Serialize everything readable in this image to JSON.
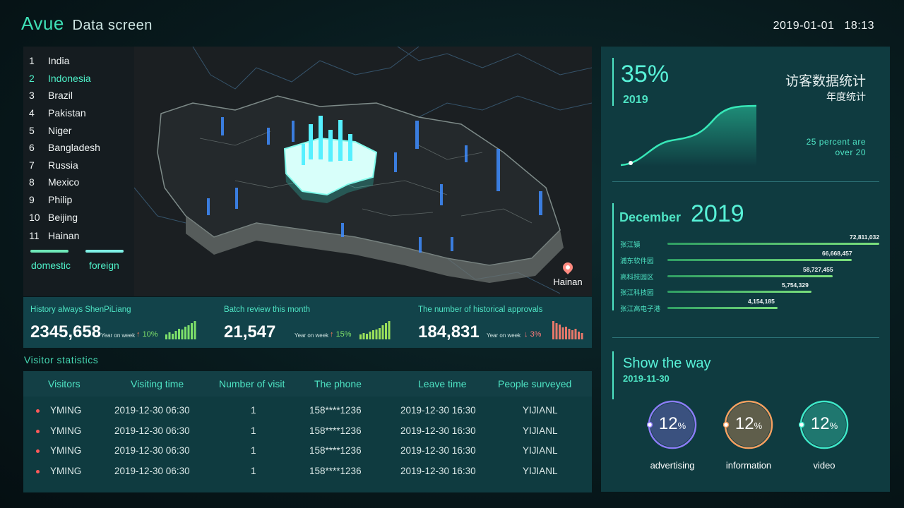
{
  "header": {
    "brand": "Avue",
    "brand_sub": "Data screen",
    "date": "2019-01-01",
    "time": "18:13"
  },
  "map": {
    "ranking": [
      {
        "num": "1",
        "name": "India"
      },
      {
        "num": "2",
        "name": "Indonesia"
      },
      {
        "num": "3",
        "name": "Brazil"
      },
      {
        "num": "4",
        "name": "Pakistan"
      },
      {
        "num": "5",
        "name": "Niger"
      },
      {
        "num": "6",
        "name": "Bangladesh"
      },
      {
        "num": "7",
        "name": "Russia"
      },
      {
        "num": "8",
        "name": "Mexico"
      },
      {
        "num": "9",
        "name": "Philip"
      },
      {
        "num": "10",
        "name": "Beijing"
      },
      {
        "num": "11",
        "name": "Hainan"
      }
    ],
    "legend": {
      "domestic": "domestic",
      "foreign": "foreign"
    },
    "location_label": "Hainan",
    "colors": {
      "domestic": "#6ee7b7",
      "foreign": "#7ff0e6",
      "highlight": "#4ef0c8"
    }
  },
  "stats": [
    {
      "title": "History always ShenPiLiang",
      "value": "2345,658",
      "yow": "Year on week",
      "arrow": "↑",
      "pct": "10%",
      "trend": "up",
      "bars": [
        6,
        9,
        7,
        11,
        13,
        12,
        16,
        18,
        20,
        23
      ],
      "color": "#7ee06a"
    },
    {
      "title": "Batch review this month",
      "value": "21,547",
      "yow": "Year on week",
      "arrow": "↑",
      "pct": "15%",
      "trend": "up",
      "bars": [
        6,
        8,
        7,
        10,
        12,
        13,
        15,
        18,
        21,
        24
      ],
      "color": "#9be05a"
    },
    {
      "title": "The number of historical approvals",
      "value": "184,831",
      "yow": "Year on week",
      "arrow": "↓",
      "pct": "3%",
      "trend": "down",
      "bars": [
        24,
        21,
        19,
        16,
        17,
        14,
        12,
        14,
        10,
        8
      ],
      "color": "#e8786a"
    }
  ],
  "visitors": {
    "title": "Visitor statistics",
    "headers": [
      "Visitors",
      "Visiting time",
      "Number of visit",
      "The phone",
      "Leave time",
      "People surveyed"
    ],
    "rows": [
      [
        "YMING",
        "2019-12-30 06:30",
        "1",
        "158****1236",
        "2019-12-30 16:30",
        "YIJIANL"
      ],
      [
        "YMING",
        "2019-12-30 06:30",
        "1",
        "158****1236",
        "2019-12-30 16:30",
        "YIJIANL"
      ],
      [
        "YMING",
        "2019-12-30 06:30",
        "1",
        "158****1236",
        "2019-12-30 16:30",
        "YIJIANL"
      ],
      [
        "YMING",
        "2019-12-30 06:30",
        "1",
        "158****1236",
        "2019-12-30 16:30",
        "YIJIANL"
      ]
    ]
  },
  "annual": {
    "percent": "35%",
    "year": "2019",
    "cn_title": "访客数据统计",
    "cn_sub": "年度统计",
    "note_line1": "25 percent are",
    "note_line2": "over 20"
  },
  "monthly": {
    "month": "December",
    "year": "2019",
    "items": [
      {
        "label": "张江镇",
        "value": "72,811,032",
        "fraction": 1.0
      },
      {
        "label": "浦东软件园",
        "value": "66,668,457",
        "fraction": 0.87
      },
      {
        "label": "高科技园区",
        "value": "58,727,455",
        "fraction": 0.78
      },
      {
        "label": "张江科技园",
        "value": "5,754,329",
        "fraction": 0.68
      },
      {
        "label": "张江高电子港",
        "value": "4,154,185",
        "fraction": 0.52
      }
    ]
  },
  "show": {
    "title": "Show the way",
    "date": "2019-11-30",
    "gauges": [
      {
        "value": "12",
        "unit": "%",
        "label": "advertising",
        "color": "#8b7cf6"
      },
      {
        "value": "12",
        "unit": "%",
        "label": "information",
        "color": "#f5a060"
      },
      {
        "value": "12",
        "unit": "%",
        "label": "video",
        "color": "#3ee8c8"
      }
    ]
  }
}
